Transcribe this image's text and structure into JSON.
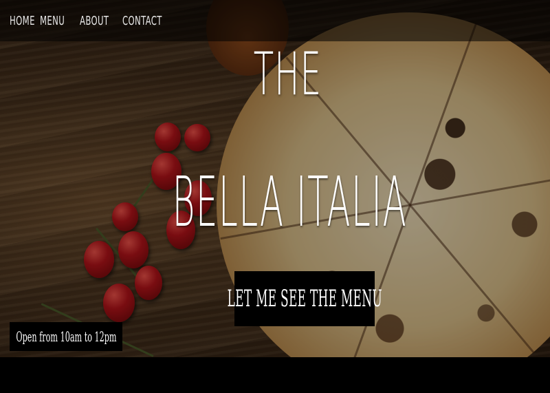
{
  "nav": {
    "items": [
      {
        "label": "Home"
      },
      {
        "label": "Menu"
      },
      {
        "label": "About"
      },
      {
        "label": "Contact"
      }
    ]
  },
  "hero": {
    "title_line1": "The",
    "title_line2": "Bella Italia",
    "cta_label": "Let me see the menu",
    "hours_text": "Open from 10am to 12pm",
    "background_image": "pizza-on-wooden-board-photo"
  },
  "colors": {
    "nav_background": "#00000080",
    "button_background": "#000000",
    "text": "#ffffff"
  }
}
